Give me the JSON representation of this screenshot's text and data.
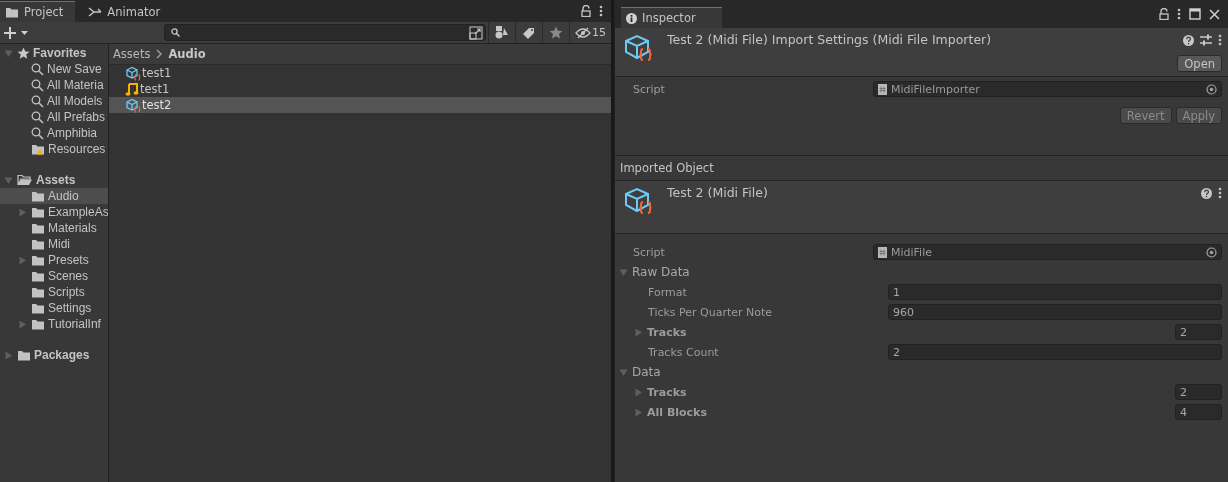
{
  "project_panel": {
    "tabs": [
      {
        "label": "Project",
        "selected": true
      },
      {
        "label": "Animator",
        "selected": false
      }
    ],
    "toolbar": {
      "hidden_count": "15"
    },
    "sidebar": {
      "items": [
        {
          "label": "Favorites",
          "kind": "star",
          "expanded": true,
          "selected": false,
          "children": [
            {
              "label": "New Save",
              "kind": "search",
              "selected": false
            },
            {
              "label": "All Materia",
              "kind": "search",
              "selected": false
            },
            {
              "label": "All Models",
              "kind": "search",
              "selected": false
            },
            {
              "label": "All Prefabs",
              "kind": "search",
              "selected": false
            },
            {
              "label": "Amphibia",
              "kind": "search",
              "selected": false
            },
            {
              "label": "Resources",
              "kind": "favfolder",
              "selected": false
            }
          ]
        },
        {
          "label": "Assets",
          "kind": "openfolder",
          "expanded": true,
          "selected": false,
          "children": [
            {
              "label": "Audio",
              "kind": "folder",
              "selected": true
            },
            {
              "label": "ExampleAs",
              "kind": "folder",
              "expanded": false,
              "selected": false
            },
            {
              "label": "Materials",
              "kind": "folder",
              "selected": false
            },
            {
              "label": "Midi",
              "kind": "folder",
              "selected": false
            },
            {
              "label": "Presets",
              "kind": "folder",
              "expanded": false,
              "selected": false
            },
            {
              "label": "Scenes",
              "kind": "folder",
              "selected": false
            },
            {
              "label": "Scripts",
              "kind": "folder",
              "selected": false
            },
            {
              "label": "Settings",
              "kind": "folder",
              "selected": false
            },
            {
              "label": "TutorialInf",
              "kind": "folder",
              "expanded": false,
              "selected": false
            }
          ]
        },
        {
          "label": "Packages",
          "kind": "folder",
          "expanded": false,
          "selected": false
        }
      ]
    },
    "breadcrumb": [
      "Assets",
      "Audio"
    ],
    "assets": [
      {
        "name": "test1",
        "kind": "midi",
        "selected": false
      },
      {
        "name": "test1",
        "kind": "audio",
        "selected": false
      },
      {
        "name": "test2",
        "kind": "midi",
        "selected": true
      }
    ]
  },
  "inspector": {
    "tab": {
      "label": "Inspector",
      "selected": true
    },
    "importer": {
      "title": "Test 2 (Midi File) Import Settings (Midi File Importer)",
      "open_button": "Open",
      "fields": [
        {
          "kind": "object",
          "label": "Script",
          "value": "MidiFileImporter"
        }
      ],
      "buttons": [
        {
          "label": "Revert",
          "disabled": true
        },
        {
          "label": "Apply",
          "disabled": true
        }
      ]
    },
    "section_title": "Imported Object",
    "asset": {
      "title": "Test 2 (Midi File)",
      "fields": [
        {
          "kind": "object",
          "label": "Script",
          "value": "MidiFile"
        },
        {
          "kind": "foldout",
          "label": "Raw Data",
          "expanded": true,
          "children": [
            {
              "kind": "field",
              "label": "Format",
              "value": "1"
            },
            {
              "kind": "field",
              "label": "Ticks Per Quarter Note",
              "value": "960"
            },
            {
              "kind": "array",
              "label": "Tracks",
              "expanded": false,
              "value": "2"
            },
            {
              "kind": "field",
              "label": "Tracks Count",
              "value": "2"
            }
          ]
        },
        {
          "kind": "foldout",
          "label": "Data",
          "expanded": true,
          "children": [
            {
              "kind": "array",
              "label": "Tracks",
              "expanded": false,
              "value": "2"
            },
            {
              "kind": "array",
              "label": "All Blocks",
              "expanded": false,
              "value": "4"
            }
          ]
        }
      ]
    }
  }
}
